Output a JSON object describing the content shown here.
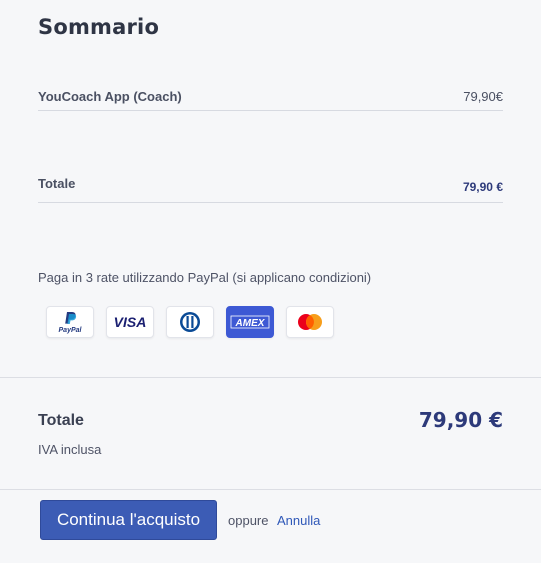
{
  "summary": {
    "title": "Sommario",
    "item": {
      "name": "YouCoach App (Coach)",
      "price": "79,90€"
    },
    "total": {
      "label": "Totale",
      "price": "79,90 €"
    }
  },
  "payment": {
    "paypal_note": "Paga in 3 rate utilizzando PayPal (si applicano condizioni)",
    "methods": [
      {
        "name": "paypal-icon",
        "label": "PayPal"
      },
      {
        "name": "visa-icon",
        "label": "VISA"
      },
      {
        "name": "diners-icon",
        "label": ""
      },
      {
        "name": "amex-icon",
        "label": "AMEX"
      },
      {
        "name": "mastercard-icon",
        "label": ""
      }
    ]
  },
  "footer": {
    "total_label": "Totale",
    "total_price": "79,90 €",
    "vat_note": "IVA inclusa",
    "continue_label": "Continua l'acquisto",
    "or_text": "oppure",
    "cancel_label": "Annulla"
  },
  "colors": {
    "primary": "#3c5cb5",
    "price_accent": "#2d3a7a",
    "link": "#2f58b8"
  }
}
